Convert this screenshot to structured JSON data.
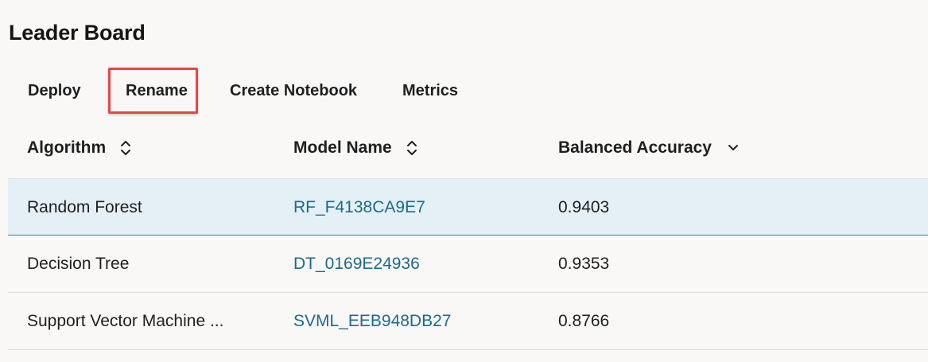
{
  "page": {
    "title": "Leader Board"
  },
  "toolbar": {
    "deploy_label": "Deploy",
    "rename_label": "Rename",
    "notebook_label": "Create Notebook",
    "metrics_label": "Metrics"
  },
  "table": {
    "columns": [
      {
        "label": "Algorithm",
        "sort_icon": "sort-both-icon"
      },
      {
        "label": "Model Name",
        "sort_icon": "sort-both-icon"
      },
      {
        "label": "Balanced Accuracy",
        "sort_icon": "chevron-down-icon"
      }
    ],
    "rows": [
      {
        "algorithm": "Random Forest",
        "model_name": "RF_F4138CA9E7",
        "accuracy": "0.9403",
        "selected": true
      },
      {
        "algorithm": "Decision Tree",
        "model_name": "DT_0169E24936",
        "accuracy": "0.9353",
        "selected": false
      },
      {
        "algorithm": "Support Vector Machine ...",
        "model_name": "SVML_EEB948DB27",
        "accuracy": "0.8766",
        "selected": false
      }
    ]
  },
  "colors": {
    "highlight": "#e0484a",
    "link": "#1c6a8a",
    "selected_row_bg": "#e4f0f6",
    "background": "#f9f8f6"
  }
}
